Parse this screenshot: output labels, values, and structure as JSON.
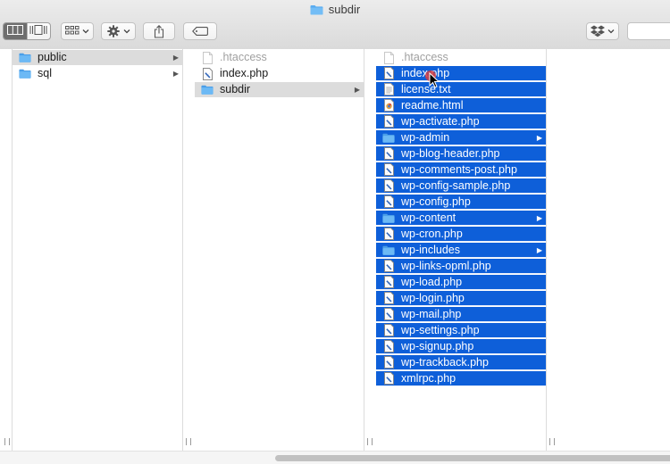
{
  "window": {
    "title": "subdir",
    "title_icon": "folder-icon"
  },
  "toolbar": {
    "view_buttons": [
      {
        "name": "column-view",
        "icon": "columns-icon",
        "active": true
      },
      {
        "name": "cover-flow-view",
        "icon": "cover-flow-icon",
        "active": false
      }
    ],
    "group_button": {
      "icon": "grid-icon",
      "has_menu": true
    },
    "action_button": {
      "icon": "gear-icon",
      "has_menu": true
    },
    "share_button": {
      "icon": "share-icon"
    },
    "tag_button": {
      "icon": "tag-icon"
    },
    "dropbox_button": {
      "icon": "dropbox-icon",
      "has_menu": true
    },
    "search": {
      "placeholder": "",
      "value": ""
    }
  },
  "columns": [
    {
      "items": [
        {
          "name": "public",
          "kind": "folder",
          "has_children": true,
          "state": "path-selected"
        },
        {
          "name": "sql",
          "kind": "folder",
          "has_children": true,
          "state": "none"
        }
      ]
    },
    {
      "items": [
        {
          "name": ".htaccess",
          "kind": "hidden-file",
          "has_children": false,
          "state": "none"
        },
        {
          "name": "index.php",
          "kind": "php-file",
          "has_children": false,
          "state": "none"
        },
        {
          "name": "subdir",
          "kind": "folder",
          "has_children": true,
          "state": "path-selected"
        }
      ]
    },
    {
      "items": [
        {
          "name": ".htaccess",
          "kind": "hidden-file",
          "has_children": false,
          "state": "none"
        },
        {
          "name": "index.php",
          "kind": "php-file",
          "has_children": false,
          "state": "selected"
        },
        {
          "name": "license.txt",
          "kind": "text-file",
          "has_children": false,
          "state": "selected"
        },
        {
          "name": "readme.html",
          "kind": "html-file",
          "has_children": false,
          "state": "selected"
        },
        {
          "name": "wp-activate.php",
          "kind": "php-file",
          "has_children": false,
          "state": "selected"
        },
        {
          "name": "wp-admin",
          "kind": "folder",
          "has_children": true,
          "state": "selected"
        },
        {
          "name": "wp-blog-header.php",
          "kind": "php-file",
          "has_children": false,
          "state": "selected"
        },
        {
          "name": "wp-comments-post.php",
          "kind": "php-file",
          "has_children": false,
          "state": "selected"
        },
        {
          "name": "wp-config-sample.php",
          "kind": "php-file",
          "has_children": false,
          "state": "selected"
        },
        {
          "name": "wp-config.php",
          "kind": "php-file",
          "has_children": false,
          "state": "selected"
        },
        {
          "name": "wp-content",
          "kind": "folder",
          "has_children": true,
          "state": "selected"
        },
        {
          "name": "wp-cron.php",
          "kind": "php-file",
          "has_children": false,
          "state": "selected"
        },
        {
          "name": "wp-includes",
          "kind": "folder",
          "has_children": true,
          "state": "selected"
        },
        {
          "name": "wp-links-opml.php",
          "kind": "php-file",
          "has_children": false,
          "state": "selected"
        },
        {
          "name": "wp-load.php",
          "kind": "php-file",
          "has_children": false,
          "state": "selected"
        },
        {
          "name": "wp-login.php",
          "kind": "php-file",
          "has_children": false,
          "state": "selected"
        },
        {
          "name": "wp-mail.php",
          "kind": "php-file",
          "has_children": false,
          "state": "selected"
        },
        {
          "name": "wp-settings.php",
          "kind": "php-file",
          "has_children": false,
          "state": "selected"
        },
        {
          "name": "wp-signup.php",
          "kind": "php-file",
          "has_children": false,
          "state": "selected"
        },
        {
          "name": "wp-trackback.php",
          "kind": "php-file",
          "has_children": false,
          "state": "selected"
        },
        {
          "name": "xmlrpc.php",
          "kind": "php-file",
          "has_children": false,
          "state": "selected"
        }
      ]
    },
    {
      "items": []
    }
  ],
  "colors": {
    "selection": "#0e5fd9",
    "path_selection": "#dcdcdc",
    "folder": "#5aacf0",
    "hidden_text": "#a0a0a0"
  }
}
